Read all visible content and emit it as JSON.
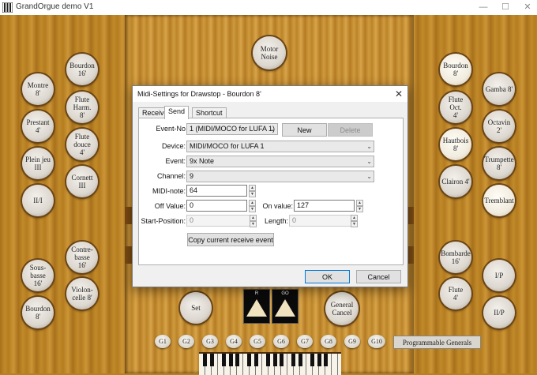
{
  "window": {
    "title": "GrandOrgue demo V1",
    "minimize": "—",
    "maximize": "☐",
    "close": "✕"
  },
  "stops_left": [
    {
      "label": "Bourdon\n16'",
      "on": false
    },
    {
      "label": "Montre\n8'",
      "on": false
    },
    {
      "label": "Flute\nHarm.\n8'",
      "on": false
    },
    {
      "label": "Prestant\n4'",
      "on": false
    },
    {
      "label": "Flute\ndouce\n4'",
      "on": false
    },
    {
      "label": "Plein jeu\nIII",
      "on": false
    },
    {
      "label": "Cornett\nIII",
      "on": false
    },
    {
      "label": "II/I",
      "on": false
    },
    {
      "label": "Contre-\nbasse\n16'",
      "on": false
    },
    {
      "label": "Sous-\nbasse\n16'",
      "on": false
    },
    {
      "label": "Violon-\ncelle 8'",
      "on": false
    },
    {
      "label": "Bourdon\n8'",
      "on": false
    }
  ],
  "stops_right": [
    {
      "label": "Bourdon\n8'",
      "on": true
    },
    {
      "label": "Gamba 8'",
      "on": false
    },
    {
      "label": "Flute\nOct.\n4'",
      "on": false
    },
    {
      "label": "Octavin\n2'",
      "on": false
    },
    {
      "label": "Hautbois\n8'",
      "on": true
    },
    {
      "label": "Trumpette\n8'",
      "on": false
    },
    {
      "label": "Clairon 4'",
      "on": false
    },
    {
      "label": "Tremblant",
      "on": true
    },
    {
      "label": "Bombarde\n16'",
      "on": false
    },
    {
      "label": "I/P",
      "on": false
    },
    {
      "label": "Flute\n4'",
      "on": false
    },
    {
      "label": "II/P",
      "on": false
    }
  ],
  "center": {
    "motor": "Motor\nNoise",
    "set": "Set",
    "general_cancel": "General\nCancel"
  },
  "swells": [
    {
      "label": "R"
    },
    {
      "label": "GO"
    }
  ],
  "generals": [
    "G1",
    "G2",
    "G3",
    "G4",
    "G5",
    "G6",
    "G7",
    "G8",
    "G9",
    "G10"
  ],
  "programmable_generals": "Programmable Generals",
  "dialog": {
    "title": "Midi-Settings for Drawstop - Bourdon 8'",
    "close": "✕",
    "tabs": [
      "Receive",
      "Send",
      "Shortcut"
    ],
    "active_tab": "Send",
    "event_no_label": "Event-No",
    "event_no_value": "1 (MIDI/MOCO for LUFA 1)",
    "new_button": "New",
    "delete_button": "Delete",
    "device_label": "Device:",
    "device_value": "MIDI/MOCO for LUFA 1",
    "event_label": "Event:",
    "event_value": "9x Note",
    "channel_label": "Channel:",
    "channel_value": "9",
    "midi_note_label": "MIDI-note:",
    "midi_note_value": "64",
    "off_value_label": "Off Value:",
    "off_value": "0",
    "on_value_label": "On value:",
    "on_value": "127",
    "start_position_label": "Start-Position:",
    "start_position_value": "0",
    "length_label": "Length:",
    "length_value": "0",
    "copy_button": "Copy current receive event",
    "ok_button": "OK",
    "cancel_button": "Cancel"
  }
}
